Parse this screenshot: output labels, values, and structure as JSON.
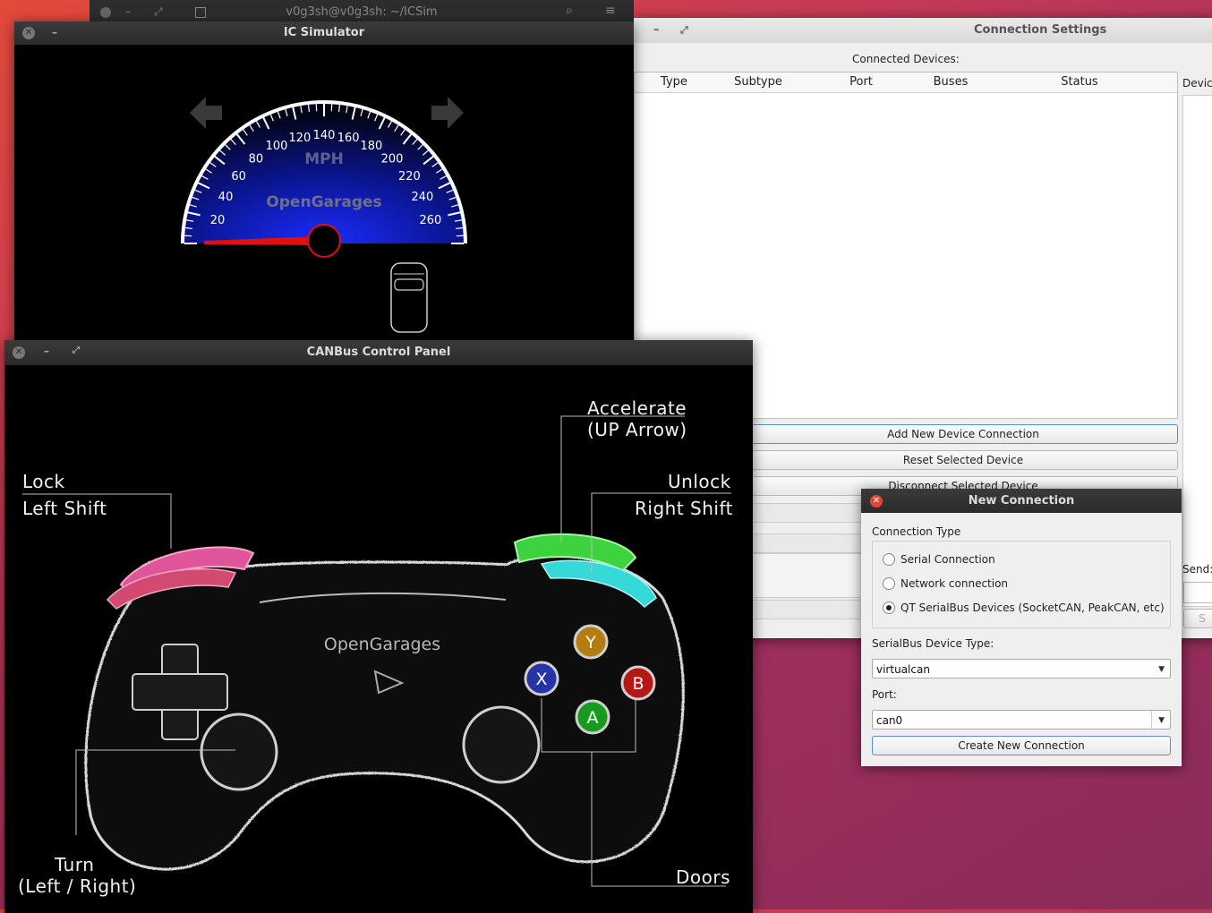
{
  "terminal": {
    "title": "v0g3sh@v0g3sh: ~/ICSim"
  },
  "connection_settings": {
    "title": "Connection Settings",
    "connected_devices_label": "Connected Devices:",
    "columns": [
      "Type",
      "Subtype",
      "Port",
      "Buses",
      "Status"
    ],
    "device_side_label": "Device",
    "send_label": "Send:",
    "send_button_partial": "S",
    "buttons": {
      "add": "Add New Device Connection",
      "reset": "Reset Selected Device",
      "disconnect": "Disconnect Selected Device"
    }
  },
  "ic_simulator": {
    "title": "IC Simulator",
    "unit": "MPH",
    "brand": "OpenGarages",
    "speed_ticks": [
      "20",
      "40",
      "60",
      "80",
      "100",
      "120",
      "140",
      "160",
      "180",
      "200",
      "220",
      "240",
      "260"
    ],
    "needle_speed": 0
  },
  "canbus_panel": {
    "title": "CANBus Control Panel",
    "brand": "OpenGarages",
    "labels": {
      "lock": "Lock",
      "left_shift": "Left Shift",
      "accelerate": "Accelerate",
      "up_arrow": "(UP Arrow)",
      "unlock": "Unlock",
      "right_shift": "Right Shift",
      "turn": "Turn",
      "left_right": "(Left / Right)",
      "doors": "Doors"
    },
    "buttons": {
      "x": "X",
      "y": "Y",
      "a": "A",
      "b": "B"
    }
  },
  "new_connection": {
    "title": "New Connection",
    "connection_type_label": "Connection Type",
    "options": [
      "Serial Connection",
      "Network connection",
      "QT SerialBus Devices (SocketCAN, PeakCAN, etc)"
    ],
    "selected_option": "QT SerialBus Devices (SocketCAN, PeakCAN, etc)",
    "device_type_label": "SerialBus Device Type:",
    "device_type_value": "virtualcan",
    "port_label": "Port:",
    "port_value": "can0",
    "create_button": "Create New Connection"
  },
  "colors": {
    "accent_blue": "#1a2cff",
    "lock_pink": "#e0559a",
    "accelerate_green": "#3fd23f",
    "unlock_cyan": "#36d8d8",
    "needle_red": "#e01010"
  }
}
